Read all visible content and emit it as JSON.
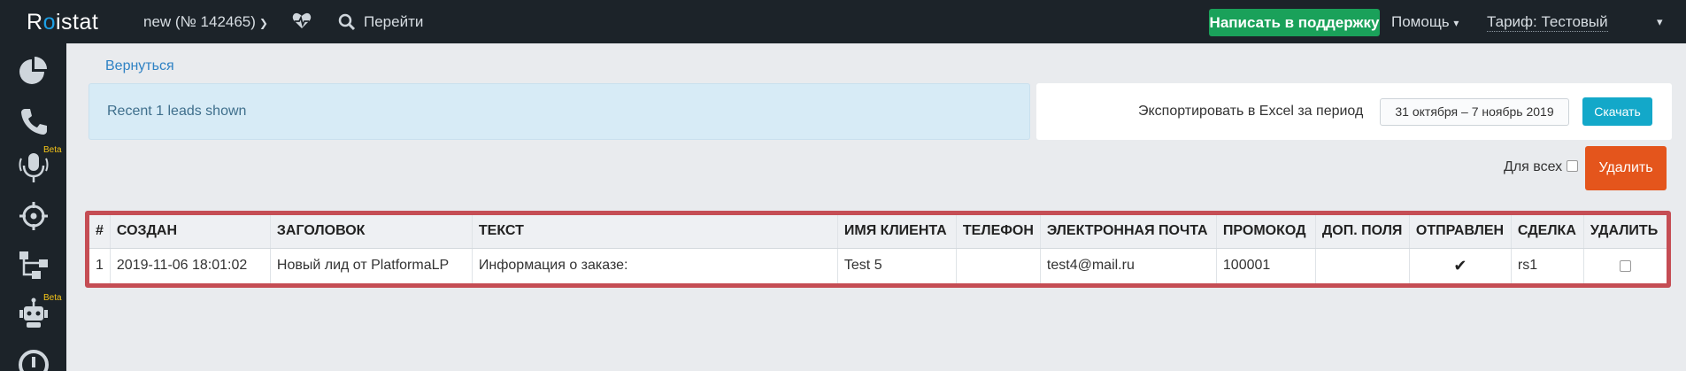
{
  "topbar": {
    "logo_pre": "R",
    "logo_o": "o",
    "logo_post": "istat",
    "project": "new  (№ 142465)",
    "goto": "Перейти",
    "support_button": "Написать в поддержку",
    "help": "Помощь",
    "tariff": "Тариф: Тестовый"
  },
  "sidebar": {
    "items": [
      {
        "icon": "pie-chart-icon"
      },
      {
        "icon": "phone-icon"
      },
      {
        "icon": "microphone-icon",
        "badge": "Beta"
      },
      {
        "icon": "target-icon"
      },
      {
        "icon": "hierarchy-icon"
      },
      {
        "icon": "robot-icon",
        "badge": "Beta"
      },
      {
        "icon": "alert-icon"
      }
    ]
  },
  "main": {
    "back_link": "Вернуться",
    "info_text": "Recent 1 leads shown",
    "export_label": "Экспортировать в Excel за период",
    "date_range": "31 октября – 7 ноябрь 2019",
    "download_button": "Скачать",
    "for_all_label": "Для всех",
    "delete_button": "Удалить"
  },
  "table": {
    "headers": [
      "#",
      "СОЗДАН",
      "ЗАГОЛОВОК",
      "ТЕКСТ",
      "ИМЯ КЛИЕНТА",
      "ТЕЛЕФОН",
      "ЭЛЕКТРОННАЯ ПОЧТА",
      "ПРОМОКОД",
      "ДОП. ПОЛЯ",
      "ОТПРАВЛЕН",
      "СДЕЛКА",
      "УДАЛИТЬ"
    ],
    "rows": [
      {
        "num": "1",
        "created": "2019-11-06 18:01:02",
        "title": "Новый лид от PlatformaLP",
        "text": "Информация о заказе:",
        "client": "Test 5",
        "phone": "",
        "email": "test4@mail.ru",
        "promo": "100001",
        "extra": "",
        "sent": "✔",
        "deal": "rs1"
      }
    ]
  },
  "colors": {
    "topbar": "#1c2329",
    "support": "#1aa15a",
    "download": "#13a8c9",
    "delete": "#e4551c",
    "highlight_frame": "#c54d54"
  }
}
